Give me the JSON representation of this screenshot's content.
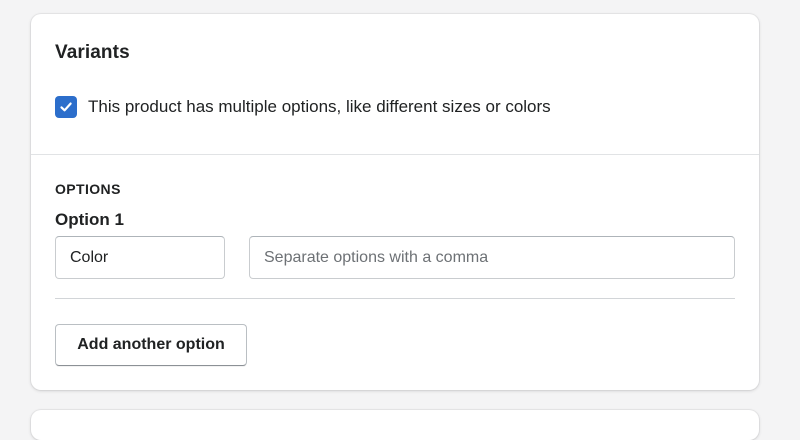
{
  "card": {
    "title": "Variants"
  },
  "multiple_options": {
    "checked": true,
    "label": "This product has multiple options, like different sizes or colors"
  },
  "options_section": {
    "heading": "OPTIONS",
    "options": [
      {
        "label": "Option 1",
        "name_value": "Color",
        "values_value": "",
        "values_placeholder": "Separate options with a comma"
      }
    ],
    "add_button_label": "Add another option"
  },
  "colors": {
    "checkbox_fill": "#2c6ecb",
    "page_background": "#f4f4f5",
    "card_background": "#ffffff",
    "text_primary": "#202223",
    "placeholder_text": "#6d7175"
  },
  "icons": {
    "checkbox_mark": "checkmark-icon"
  }
}
